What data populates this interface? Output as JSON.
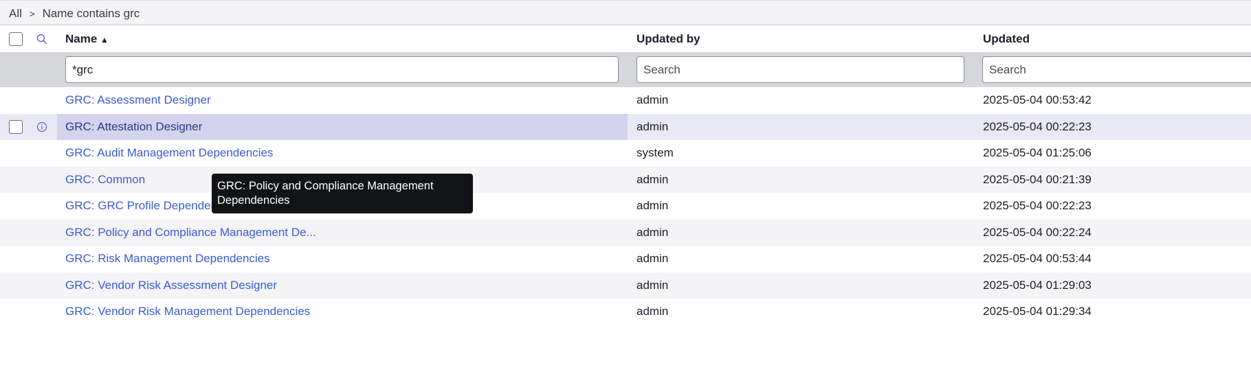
{
  "breadcrumb": {
    "root": "All",
    "separator": ">",
    "filter": "Name contains grc"
  },
  "columns": {
    "name": "Name",
    "updated_by": "Updated by",
    "updated": "Updated"
  },
  "filters": {
    "name_value": "*grc",
    "updated_by_placeholder": "Search",
    "updated_placeholder": "Search"
  },
  "rows": [
    {
      "name": "GRC: Assessment Designer",
      "updated_by": "admin",
      "updated": "2025-05-04 00:53:42"
    },
    {
      "name": "GRC: Attestation Designer",
      "updated_by": "admin",
      "updated": "2025-05-04 00:22:23"
    },
    {
      "name": "GRC: Audit Management Dependencies",
      "updated_by": "system",
      "updated": "2025-05-04 01:25:06"
    },
    {
      "name": "GRC: Common",
      "updated_by": "admin",
      "updated": "2025-05-04 00:21:39"
    },
    {
      "name": "GRC: GRC Profile Dependencies",
      "updated_by": "admin",
      "updated": "2025-05-04 00:22:23"
    },
    {
      "name": "GRC: Policy and Compliance Management De...",
      "updated_by": "admin",
      "updated": "2025-05-04 00:22:24"
    },
    {
      "name": "GRC: Risk Management Dependencies",
      "updated_by": "admin",
      "updated": "2025-05-04 00:53:44"
    },
    {
      "name": "GRC: Vendor Risk Assessment Designer",
      "updated_by": "admin",
      "updated": "2025-05-04 01:29:03"
    },
    {
      "name": "GRC: Vendor Risk Management Dependencies",
      "updated_by": "admin",
      "updated": "2025-05-04 01:29:34"
    }
  ],
  "tooltip": "GRC: Policy and Compliance Management Dependencies"
}
